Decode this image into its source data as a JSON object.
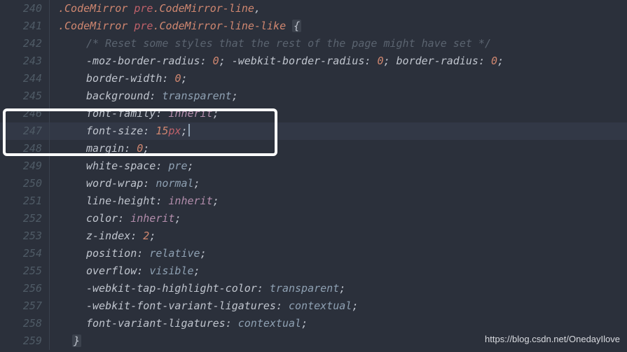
{
  "editor": {
    "first_line": 240,
    "gutter": [
      "240",
      "241",
      "242",
      "243",
      "244",
      "245",
      "246",
      "247",
      "248",
      "249",
      "250",
      "251",
      "252",
      "253",
      "254",
      "255",
      "256",
      "257",
      "258",
      "259"
    ],
    "highlight_line_index": 7,
    "box": {
      "top_line_index": 6,
      "bottom_line_index": 8
    },
    "lines": {
      "l0": {
        "a": ".CodeMirror",
        "b": "pre",
        "c": ".CodeMirror-line",
        "d": ","
      },
      "l1": {
        "a": ".CodeMirror",
        "b": "pre",
        "c": ".CodeMirror-line-like",
        "d": "{"
      },
      "l2": {
        "a": "/* Reset some styles that the rest of the page might have set */"
      },
      "l3": {
        "a": "-moz-border-radius",
        "b": "0",
        "c": "-webkit-border-radius",
        "d": "0",
        "e": "border-radius",
        "f": "0"
      },
      "l4": {
        "a": "border-width",
        "b": "0"
      },
      "l5": {
        "a": "background",
        "b": "transparent"
      },
      "l6": {
        "a": "font-family",
        "b": "inherit"
      },
      "l7": {
        "a": "font-size",
        "b": "15",
        "c": "px"
      },
      "l8": {
        "a": "margin",
        "b": "0"
      },
      "l9": {
        "a": "white-space",
        "b": "pre"
      },
      "l10": {
        "a": "word-wrap",
        "b": "normal"
      },
      "l11": {
        "a": "line-height",
        "b": "inherit"
      },
      "l12": {
        "a": "color",
        "b": "inherit"
      },
      "l13": {
        "a": "z-index",
        "b": "2"
      },
      "l14": {
        "a": "position",
        "b": "relative"
      },
      "l15": {
        "a": "overflow",
        "b": "visible"
      },
      "l16": {
        "a": "-webkit-tap-highlight-color",
        "b": "transparent"
      },
      "l17": {
        "a": "-webkit-font-variant-ligatures",
        "b": "contextual"
      },
      "l18": {
        "a": "font-variant-ligatures",
        "b": "contextual"
      },
      "l19": {
        "a": "}"
      }
    }
  },
  "watermark": "https://blog.csdn.net/OnedayIlove"
}
